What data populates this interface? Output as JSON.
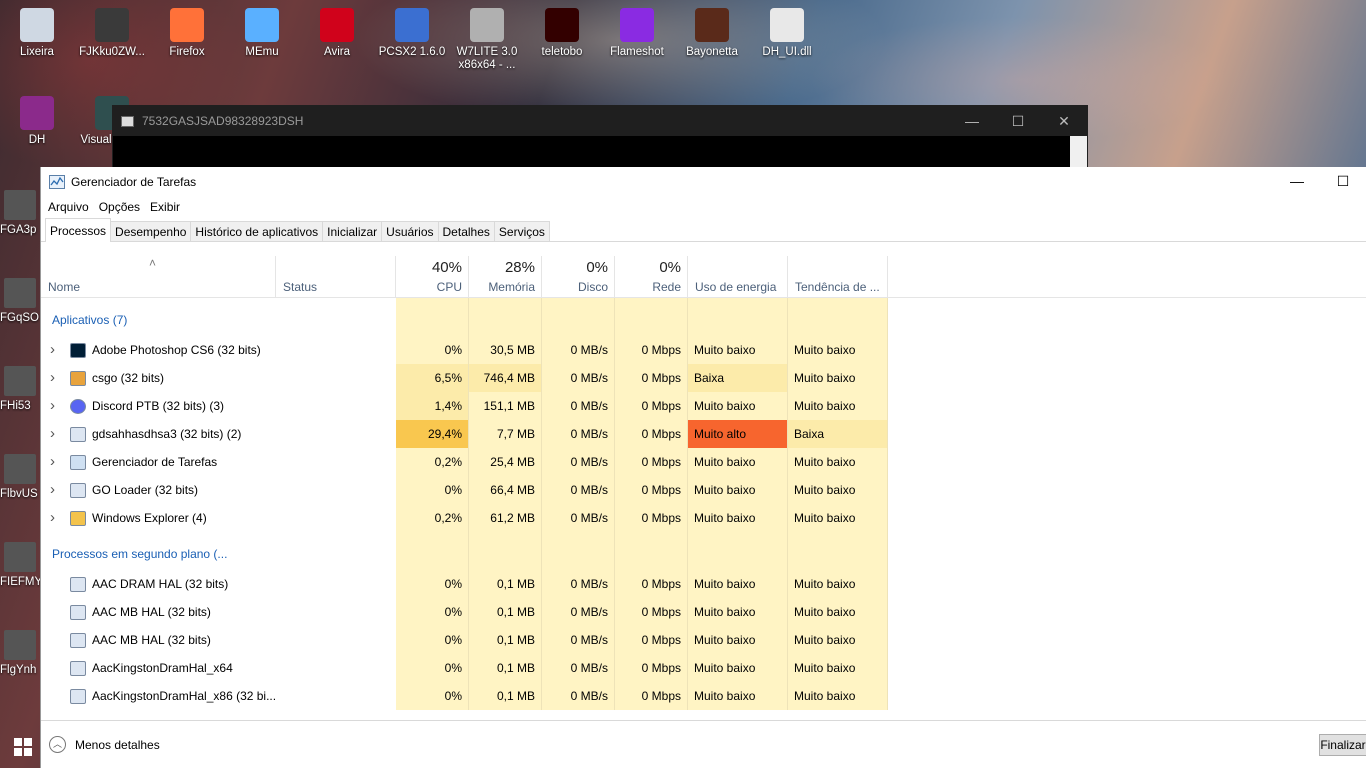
{
  "desktop": {
    "top_icons": [
      {
        "label": "Lixeira",
        "icon": "recycle-bin-icon"
      },
      {
        "label": "FJKku0ZW...",
        "icon": "file-icon"
      },
      {
        "label": "Firefox",
        "icon": "firefox-icon"
      },
      {
        "label": "MEmu",
        "icon": "memu-icon"
      },
      {
        "label": "Avira",
        "icon": "avira-icon"
      },
      {
        "label": "PCSX2 1.6.0",
        "icon": "pcsx2-icon"
      },
      {
        "label": "W7LITE 3.0 x86x64 - ...",
        "icon": "disc-icon"
      },
      {
        "label": "teletobo",
        "icon": "illustrator-icon"
      },
      {
        "label": "Flameshot",
        "icon": "flameshot-icon"
      },
      {
        "label": "Bayonetta",
        "icon": "bayonetta-icon"
      },
      {
        "label": "DH_UI.dll",
        "icon": "dll-file-icon"
      }
    ],
    "second_row": [
      {
        "label": "DH",
        "icon": "winrar-icon"
      },
      {
        "label": "Visual de fot",
        "icon": "photo-viewer-icon"
      }
    ],
    "left_column": [
      {
        "label": "FGA3p"
      },
      {
        "label": "FGqSO"
      },
      {
        "label": "FHi53"
      },
      {
        "label": "FlbvUS"
      },
      {
        "label": "FIEFMY"
      },
      {
        "label": "FlgYnh"
      }
    ]
  },
  "console_window": {
    "title": "7532GASJSAD98328923DSH",
    "controls": {
      "minimize": "—",
      "maximize": "☐",
      "close": "✕"
    }
  },
  "task_manager": {
    "title": "Gerenciador de Tarefas",
    "controls": {
      "minimize": "—",
      "maximize": "☐"
    },
    "menu": [
      "Arquivo",
      "Opções",
      "Exibir"
    ],
    "tabs": [
      "Processos",
      "Desempenho",
      "Histórico de aplicativos",
      "Inicializar",
      "Usuários",
      "Detalhes",
      "Serviços"
    ],
    "active_tab": "Processos",
    "columns": {
      "name": "Nome",
      "status": "Status",
      "cpu": {
        "pct": "40%",
        "label": "CPU"
      },
      "memory": {
        "pct": "28%",
        "label": "Memória"
      },
      "disk": {
        "pct": "0%",
        "label": "Disco"
      },
      "network": {
        "pct": "0%",
        "label": "Rede"
      },
      "power": "Uso de energia",
      "power_trend": "Tendência de ..."
    },
    "groups": [
      {
        "title": "Aplicativos (7)",
        "rows": [
          {
            "name": "Adobe Photoshop CS6 (32 bits)",
            "icon": "photoshop-icon",
            "cpu": "0%",
            "mem": "30,5 MB",
            "disk": "0 MB/s",
            "net": "0 Mbps",
            "power": "Muito baixo",
            "trend": "Muito baixo",
            "expandable": true
          },
          {
            "name": "csgo (32 bits)",
            "icon": "csgo-icon",
            "cpu": "6,5%",
            "mem": "746,4 MB",
            "disk": "0 MB/s",
            "net": "0 Mbps",
            "power": "Baixa",
            "trend": "Muito baixo",
            "expandable": true
          },
          {
            "name": "Discord PTB (32 bits) (3)",
            "icon": "discord-icon",
            "cpu": "1,4%",
            "mem": "151,1 MB",
            "disk": "0 MB/s",
            "net": "0 Mbps",
            "power": "Muito baixo",
            "trend": "Muito baixo",
            "expandable": true
          },
          {
            "name": "gdsahhasdhsa3 (32 bits) (2)",
            "icon": "app-window-icon",
            "cpu": "29,4%",
            "mem": "7,7 MB",
            "disk": "0 MB/s",
            "net": "0 Mbps",
            "power": "Muito alto",
            "trend": "Baixa",
            "expandable": true
          },
          {
            "name": "Gerenciador de Tarefas",
            "icon": "task-manager-icon",
            "cpu": "0,2%",
            "mem": "25,4 MB",
            "disk": "0 MB/s",
            "net": "0 Mbps",
            "power": "Muito baixo",
            "trend": "Muito baixo",
            "expandable": true
          },
          {
            "name": "GO Loader (32 bits)",
            "icon": "app-window-icon",
            "cpu": "0%",
            "mem": "66,4 MB",
            "disk": "0 MB/s",
            "net": "0 Mbps",
            "power": "Muito baixo",
            "trend": "Muito baixo",
            "expandable": true
          },
          {
            "name": "Windows Explorer (4)",
            "icon": "folder-icon",
            "cpu": "0,2%",
            "mem": "61,2 MB",
            "disk": "0 MB/s",
            "net": "0 Mbps",
            "power": "Muito baixo",
            "trend": "Muito baixo",
            "expandable": true
          }
        ]
      },
      {
        "title": "Processos em segundo plano (...",
        "rows": [
          {
            "name": "AAC DRAM HAL (32 bits)",
            "icon": "app-window-icon",
            "cpu": "0%",
            "mem": "0,1 MB",
            "disk": "0 MB/s",
            "net": "0 Mbps",
            "power": "Muito baixo",
            "trend": "Muito baixo",
            "expandable": false
          },
          {
            "name": "AAC MB HAL (32 bits)",
            "icon": "app-window-icon",
            "cpu": "0%",
            "mem": "0,1 MB",
            "disk": "0 MB/s",
            "net": "0 Mbps",
            "power": "Muito baixo",
            "trend": "Muito baixo",
            "expandable": false
          },
          {
            "name": "AAC MB HAL (32 bits)",
            "icon": "app-window-icon",
            "cpu": "0%",
            "mem": "0,1 MB",
            "disk": "0 MB/s",
            "net": "0 Mbps",
            "power": "Muito baixo",
            "trend": "Muito baixo",
            "expandable": false
          },
          {
            "name": "AacKingstonDramHal_x64",
            "icon": "app-window-icon",
            "cpu": "0%",
            "mem": "0,1 MB",
            "disk": "0 MB/s",
            "net": "0 Mbps",
            "power": "Muito baixo",
            "trend": "Muito baixo",
            "expandable": false
          },
          {
            "name": "AacKingstonDramHal_x86 (32 bi...",
            "icon": "app-window-icon",
            "cpu": "0%",
            "mem": "0,1 MB",
            "disk": "0 MB/s",
            "net": "0 Mbps",
            "power": "Muito baixo",
            "trend": "Muito baixo",
            "expandable": false
          }
        ]
      }
    ],
    "footer": {
      "less_details": "Menos detalhes",
      "end_task": "Finalizar"
    },
    "colors": {
      "heat_light": "#fff4c4",
      "heat_mid": "#fcebaa",
      "heat_strong": "#f9c74f",
      "power_high": "#f7652e",
      "group_title": "#1a5fb4"
    }
  }
}
